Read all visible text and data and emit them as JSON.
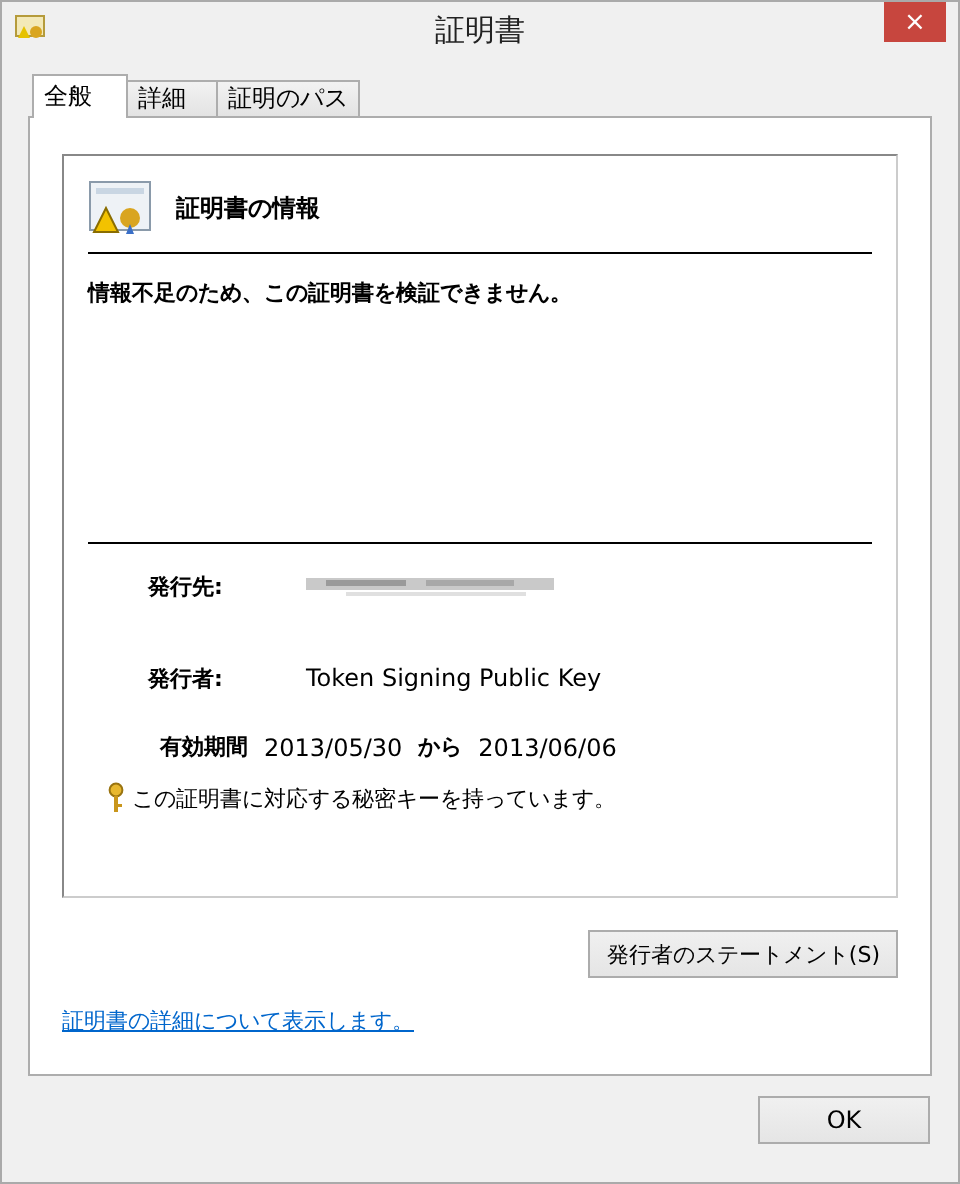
{
  "window": {
    "title": "証明書",
    "close": "×"
  },
  "tabs": [
    {
      "label": "全般",
      "selected": true
    },
    {
      "label": "詳細",
      "selected": false
    },
    {
      "label": "証明のパス",
      "selected": false
    }
  ],
  "info": {
    "heading": "証明書の情報",
    "message": "情報不足のため、この証明書を検証できません。"
  },
  "fields": [
    {
      "label": "発行先:",
      "kind": "redacted"
    },
    {
      "label": "発行者:",
      "kind": "text",
      "value": "Token Signing Public Key"
    }
  ],
  "validity": {
    "label": "有効期間",
    "from": "2013/05/30",
    "word": "から",
    "to": "2013/06/06"
  },
  "key_note": "この証明書に対応する秘密キーを持っています。",
  "statement_button": "発行者のステートメント(S)",
  "details_link": "証明書の詳細について表示します。",
  "ok_button": "OK"
}
